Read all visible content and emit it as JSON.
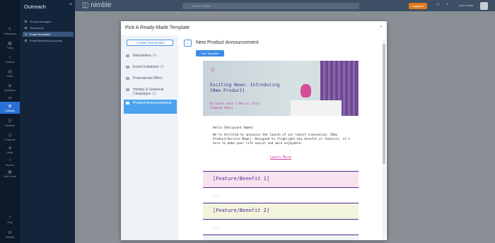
{
  "nav": {
    "items": [
      {
        "label": "Onboarding",
        "icon": "onboarding-icon",
        "glyph": "✎"
      },
      {
        "label": "Today",
        "icon": "calendar-icon",
        "glyph": "▦"
      },
      {
        "label": "Contacts",
        "icon": "contacts-icon",
        "glyph": "☺"
      },
      {
        "label": "Deals",
        "icon": "deals-icon",
        "glyph": "▤"
      },
      {
        "label": "Workflows",
        "icon": "workflows-icon",
        "glyph": "⊞"
      },
      {
        "label": "Messages",
        "icon": "messages-icon",
        "glyph": "✉"
      },
      {
        "label": "Outreach",
        "icon": "outreach-icon",
        "glyph": "⊛"
      },
      {
        "label": "Activities",
        "icon": "activities-icon",
        "glyph": "☰"
      },
      {
        "label": "Prospects",
        "icon": "prospects-icon",
        "glyph": "◎"
      },
      {
        "label": "Deals",
        "icon": "deals2-icon",
        "glyph": "◈"
      },
      {
        "label": "Reports",
        "icon": "reports-icon",
        "glyph": "⌇"
      },
      {
        "label": "Web Forms",
        "icon": "webforms-icon",
        "glyph": "▣"
      },
      {
        "label": "Help",
        "icon": "help-icon",
        "glyph": "?"
      },
      {
        "label": "Settings",
        "icon": "settings-icon",
        "glyph": "⚙"
      }
    ]
  },
  "subnav": {
    "title": "Outreach",
    "items": [
      "Group Messages",
      "Sequences",
      "Email Templates",
      "Email Marketing Accounts"
    ]
  },
  "topbar": {
    "logo": "nimble",
    "search_placeholder": "Search Nimble",
    "upgrade": "Upgrade",
    "user": "John Smith"
  },
  "modal": {
    "title": "Pick A Ready-Made Template",
    "close": "×",
    "create_button": "+ Create from Scratch",
    "categories": [
      {
        "label": "Newsletters",
        "count": "(4)"
      },
      {
        "label": "Event Invitations",
        "count": "(4)"
      },
      {
        "label": "Promotional Offers",
        "count": ""
      },
      {
        "label": "Holiday & Seasonal Campaigns",
        "count": "(3)"
      },
      {
        "label": "Product Announcements",
        "count": ""
      }
    ],
    "back": "←",
    "preview_title": "New Product Announcement",
    "use_button": "Use Template"
  },
  "email": {
    "headline": "Exciting News: Introducing [New Product]",
    "subheadline": "Discover what's New at [Your Company Name]",
    "greeting": "Hello [Recipient Name]",
    "body": "We're thrilled to announce the launch of our latest innovation: [New Product/Service Name]. Designed to [highlight key benefit or feature], it's here to make your life easier and more enjoyable.",
    "cta": "Learn More",
    "features": [
      "[Feature/Benefit 1]",
      "[Feature/Benefit 2]"
    ],
    "ellipsis": "...",
    "colors": {
      "purple": "#4b2a93",
      "pink": "#d23fa3",
      "feature1_bg": "#f7e3ef",
      "feature2_bg": "#f2f4dc"
    }
  }
}
